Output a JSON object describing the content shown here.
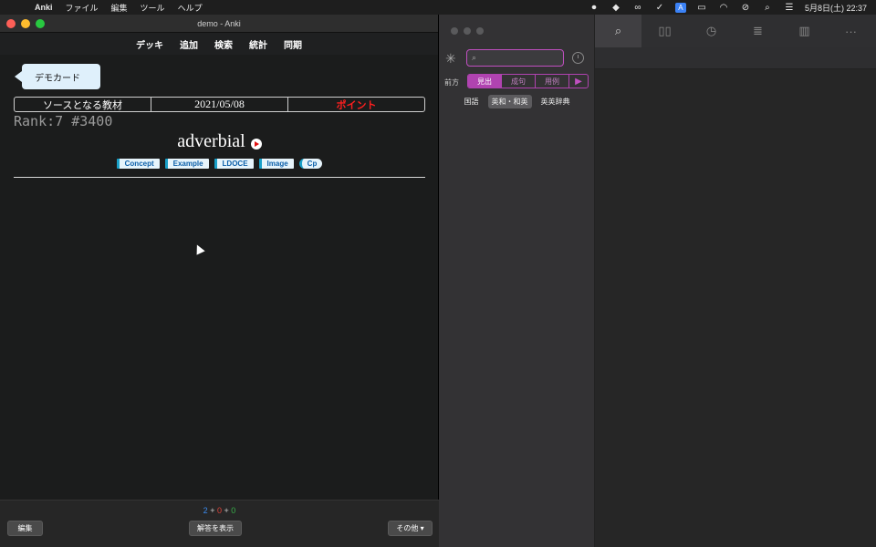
{
  "menubar": {
    "apple_icon": "apple-logo-icon",
    "app_name": "Anki",
    "items": [
      "ファイル",
      "編集",
      "ツール",
      "ヘルプ"
    ],
    "status_icons": [
      "record-icon",
      "dropbox-icon",
      "glasses-icon",
      "checkmark-icon",
      "input-a-icon",
      "battery-icon",
      "wifi-icon",
      "muted-icon",
      "search-icon",
      "control-center-icon"
    ],
    "input_letter": "A",
    "clock": "5月8日(土)  22:37"
  },
  "anki": {
    "window_title": "demo - Anki",
    "toolbar": [
      "デッキ",
      "追加",
      "検索",
      "統計",
      "同期"
    ],
    "deck_tag": "デモカード",
    "info_table": {
      "source": "ソースとなる教材",
      "date": "2021/05/08",
      "point": "ポイント"
    },
    "rank": "Rank:7 #3400",
    "word": "adverbial",
    "links": [
      "Concept",
      "Example",
      "LDOCE",
      "Image",
      "Cp"
    ],
    "counts": {
      "new": "2",
      "learn": "0",
      "review": "0",
      "plus": "+"
    },
    "buttons": {
      "edit": "編集",
      "show_answer": "解答を表示",
      "more": "その他 ▾"
    }
  },
  "dictionary": {
    "search_placeholder": "",
    "search_label": "前方",
    "segments": [
      "見出",
      "成句",
      "用例"
    ],
    "dict_tabs": [
      "国語",
      "英和・和英",
      "英英辞典"
    ],
    "toolbar_icons": [
      "search-icon",
      "book-icon",
      "history-icon",
      "list-icon",
      "columns-icon",
      "more-icon"
    ]
  },
  "colors": {
    "accent": "#b043b0",
    "new_count": "#3b8cf0",
    "learn_count": "#e0443a",
    "review_count": "#38b04a",
    "point": "#ff1f1f"
  }
}
